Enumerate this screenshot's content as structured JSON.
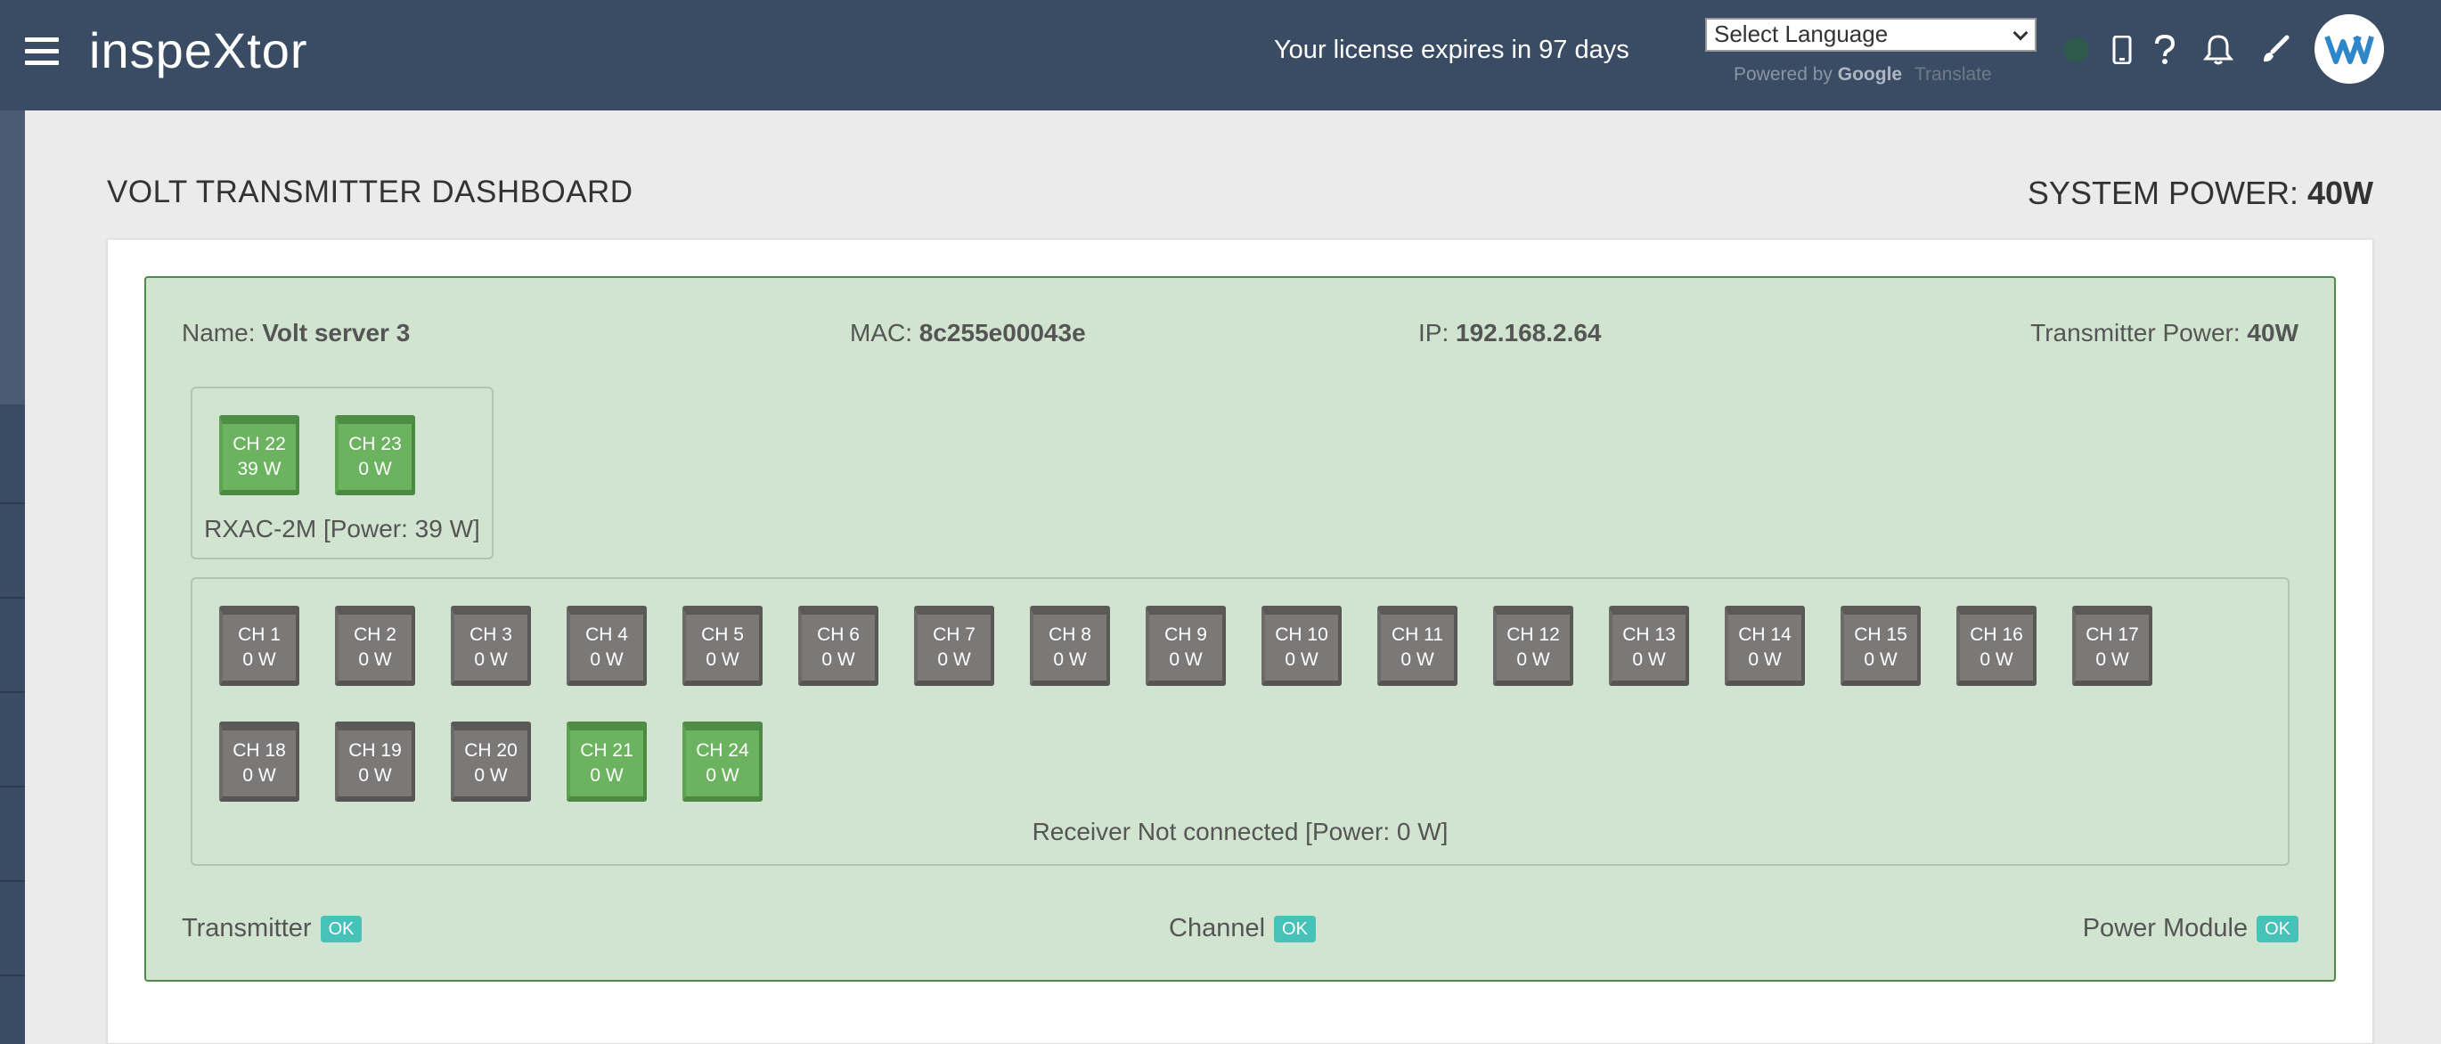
{
  "app": {
    "name": "inspeXtor",
    "license_text": "Your license expires in 97 days"
  },
  "language": {
    "selected": "Select Language",
    "powered_by": "Powered by",
    "google": "Google",
    "translate": "Translate"
  },
  "icons": {
    "menu": "hamburger-icon",
    "mobile": "mobile-icon",
    "help": "question-icon",
    "bell": "bell-icon",
    "brush": "brush-icon",
    "avatar": "user-avatar-logo"
  },
  "colors": {
    "topbar": "#3a4c64",
    "panel_bg": "#d0e4d0",
    "panel_border": "#4e8a4a",
    "channel_on": "#6cb35f",
    "channel_off": "#7b7878",
    "ok_badge": "#46c2b8"
  },
  "page": {
    "title": "VOLT TRANSMITTER DASHBOARD",
    "system_power_label": "SYSTEM POWER:",
    "system_power_value": "40W"
  },
  "transmitter": {
    "name_label": "Name:",
    "name_value": "Volt server 3",
    "mac_label": "MAC:",
    "mac_value": "8c255e00043e",
    "ip_label": "IP:",
    "ip_value": "192.168.2.64",
    "power_label": "Transmitter Power:",
    "power_value": "40W"
  },
  "receiver_1": {
    "label": "RXAC-2M [Power: 39 W]",
    "channels": [
      {
        "name": "CH 22",
        "power": "39 W",
        "active": true
      },
      {
        "name": "CH 23",
        "power": "0 W",
        "active": true
      }
    ]
  },
  "receiver_2": {
    "label": "Receiver Not connected [Power: 0 W]",
    "channels": [
      {
        "name": "CH 1",
        "power": "0 W",
        "active": false
      },
      {
        "name": "CH 2",
        "power": "0 W",
        "active": false
      },
      {
        "name": "CH 3",
        "power": "0 W",
        "active": false
      },
      {
        "name": "CH 4",
        "power": "0 W",
        "active": false
      },
      {
        "name": "CH 5",
        "power": "0 W",
        "active": false
      },
      {
        "name": "CH 6",
        "power": "0 W",
        "active": false
      },
      {
        "name": "CH 7",
        "power": "0 W",
        "active": false
      },
      {
        "name": "CH 8",
        "power": "0 W",
        "active": false
      },
      {
        "name": "CH 9",
        "power": "0 W",
        "active": false
      },
      {
        "name": "CH 10",
        "power": "0 W",
        "active": false
      },
      {
        "name": "CH 11",
        "power": "0 W",
        "active": false
      },
      {
        "name": "CH 12",
        "power": "0 W",
        "active": false
      },
      {
        "name": "CH 13",
        "power": "0 W",
        "active": false
      },
      {
        "name": "CH 14",
        "power": "0 W",
        "active": false
      },
      {
        "name": "CH 15",
        "power": "0 W",
        "active": false
      },
      {
        "name": "CH 16",
        "power": "0 W",
        "active": false
      },
      {
        "name": "CH 17",
        "power": "0 W",
        "active": false
      },
      {
        "name": "CH 18",
        "power": "0 W",
        "active": false
      },
      {
        "name": "CH 19",
        "power": "0 W",
        "active": false
      },
      {
        "name": "CH 20",
        "power": "0 W",
        "active": false
      },
      {
        "name": "CH 21",
        "power": "0 W",
        "active": true
      },
      {
        "name": "CH 24",
        "power": "0 W",
        "active": true
      }
    ]
  },
  "status": {
    "transmitter_label": "Transmitter",
    "transmitter_badge": "OK",
    "channel_label": "Channel",
    "channel_badge": "OK",
    "power_module_label": "Power Module",
    "power_module_badge": "OK"
  }
}
